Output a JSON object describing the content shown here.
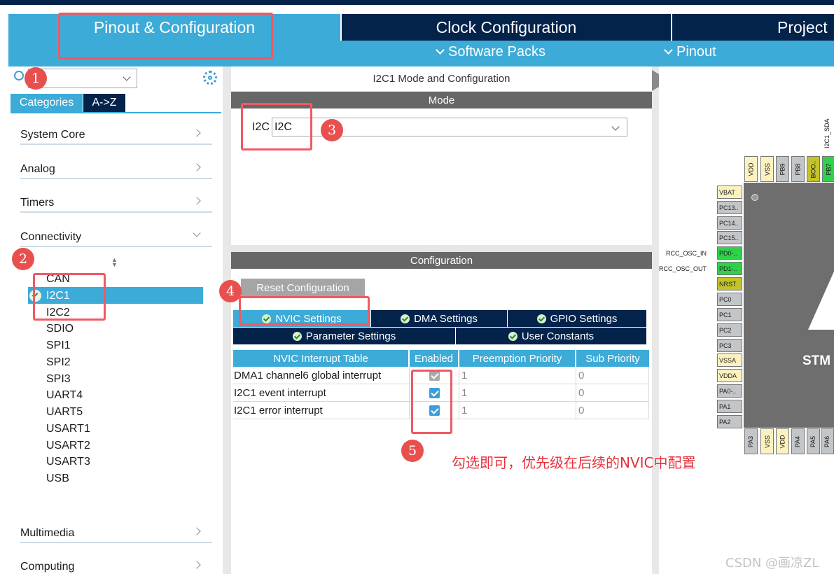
{
  "tabs": {
    "pinout": "Pinout & Configuration",
    "clock": "Clock Configuration",
    "project": "Project"
  },
  "subtabs": {
    "software": "Software Packs",
    "pinout": "Pinout"
  },
  "left": {
    "search_value": "",
    "tab_categories": "Categories",
    "tab_az": "A->Z",
    "categories": [
      "System Core",
      "Analog",
      "Timers",
      "Connectivity",
      "Multimedia",
      "Computing"
    ],
    "connectivity_items": [
      "CAN",
      "I2C1",
      "I2C2",
      "SDIO",
      "SPI1",
      "SPI2",
      "SPI3",
      "UART4",
      "UART5",
      "USART1",
      "USART2",
      "USART3",
      "USB"
    ]
  },
  "middle": {
    "title": "I2C1 Mode and Configuration",
    "mode_header": "Mode",
    "mode_label": "I2C",
    "mode_value": "I2C",
    "config_header": "Configuration",
    "reset_button": "Reset Configuration",
    "tabs": [
      "NVIC Settings",
      "DMA Settings",
      "GPIO Settings",
      "Parameter Settings",
      "User Constants"
    ],
    "table_headers": [
      "NVIC Interrupt Table",
      "Enabled",
      "Preemption Priority",
      "Sub Priority"
    ],
    "rows": [
      {
        "name": "DMA1 channel6 global interrupt",
        "enabled": true,
        "locked": true,
        "pre": "1",
        "sub": "0"
      },
      {
        "name": "I2C1 event interrupt",
        "enabled": true,
        "locked": false,
        "pre": "1",
        "sub": "0"
      },
      {
        "name": "I2C1 error interrupt",
        "enabled": true,
        "locked": false,
        "pre": "1",
        "sub": "0"
      }
    ]
  },
  "chip": {
    "label": "STM",
    "top_signal": "I2C1_SDA",
    "top_pins": [
      "VDD",
      "VSS",
      "PB9",
      "PB8",
      "BOO..",
      "PB7"
    ],
    "left_pins": [
      "VBAT",
      "PC13..",
      "PC14..",
      "PC15..",
      "PD0-..",
      "PD1-..",
      "NRST",
      "PC0",
      "PC1",
      "PC2",
      "PC3",
      "VSSA",
      "VDDA",
      "PA0-..",
      "PA1",
      "PA2"
    ],
    "bottom_pins": [
      "PA3",
      "VSS",
      "VDD",
      "PA4",
      "PA5",
      "PA6"
    ],
    "left_signals": {
      "osc_in": "RCC_OSC_IN",
      "osc_out": "RCC_OSC_OUT"
    },
    "colors": {
      "power": "#fcf2c0",
      "active": "#2ed24a",
      "reset": "#c3c32a",
      "pin": "#c3c6c9"
    }
  },
  "annotations": {
    "markers": [
      "1",
      "2",
      "3",
      "4",
      "5"
    ],
    "note": "勾选即可，优先级在后续的NVIC中配置",
    "watermark": "CSDN @画凉ZL"
  },
  "colors": {
    "navy": "#03234b",
    "accent": "#3cabd8",
    "annotation": "#ef5a62",
    "annotation_text": "#e8303a"
  }
}
